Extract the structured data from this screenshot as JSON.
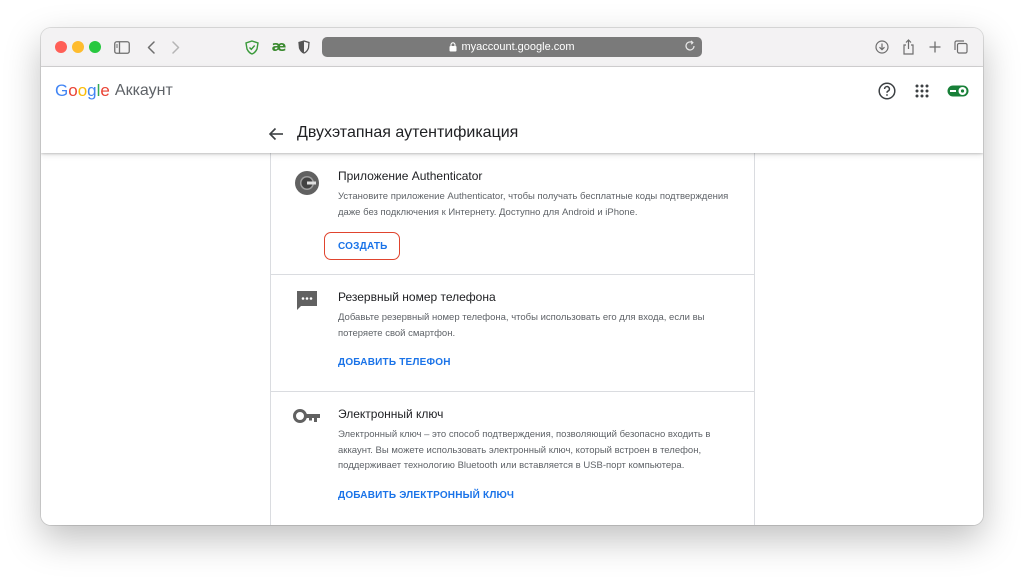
{
  "browser": {
    "url": "myaccount.google.com",
    "icons": [
      "sidebar-icon",
      "back-icon",
      "forward-icon",
      "shield-icon",
      "ae-extension-icon",
      "privacy-icon",
      "lock-icon",
      "reload-icon",
      "download-icon",
      "share-icon",
      "new-tab-icon",
      "tabs-icon"
    ],
    "ext_label": "æ"
  },
  "header": {
    "logo_letters": [
      "G",
      "o",
      "o",
      "g",
      "l",
      "e"
    ],
    "logo_colors": [
      "#4285f4",
      "#ea4335",
      "#fbbc05",
      "#4285f4",
      "#34a853",
      "#ea4335"
    ],
    "product": "Аккаунт",
    "page_title": "Двухэтапная аутентификация",
    "icons": [
      "help-icon",
      "apps-grid-icon",
      "toggle-icon"
    ]
  },
  "sections": [
    {
      "icon": "authenticator-icon",
      "title": "Приложение Authenticator",
      "description": "Установите приложение Authenticator, чтобы получать бесплатные коды подтверждения даже без подключения к Интернету. Доступно для Android и iPhone.",
      "action": "СОЗДАТЬ",
      "highlighted": true
    },
    {
      "icon": "message-icon",
      "title": "Резервный номер телефона",
      "description": "Добавьте резервный номер телефона, чтобы использовать его для входа, если вы потеряете свой смартфон.",
      "action": "ДОБАВИТЬ ТЕЛЕФОН",
      "highlighted": false
    },
    {
      "icon": "key-icon",
      "title": "Электронный ключ",
      "description": "Электронный ключ – это способ подтверждения, позволяющий безопасно входить в аккаунт. Вы можете использовать электронный ключ, который встроен в телефон, поддерживает технологию Bluetooth или вставляется в USB-порт компьютера.",
      "action": "ДОБАВИТЬ ЭЛЕКТРОННЫЙ КЛЮЧ",
      "highlighted": false
    }
  ],
  "colors": {
    "accent": "#1a73e8",
    "highlight": "#e0442e",
    "toggle_on": "#188038"
  }
}
